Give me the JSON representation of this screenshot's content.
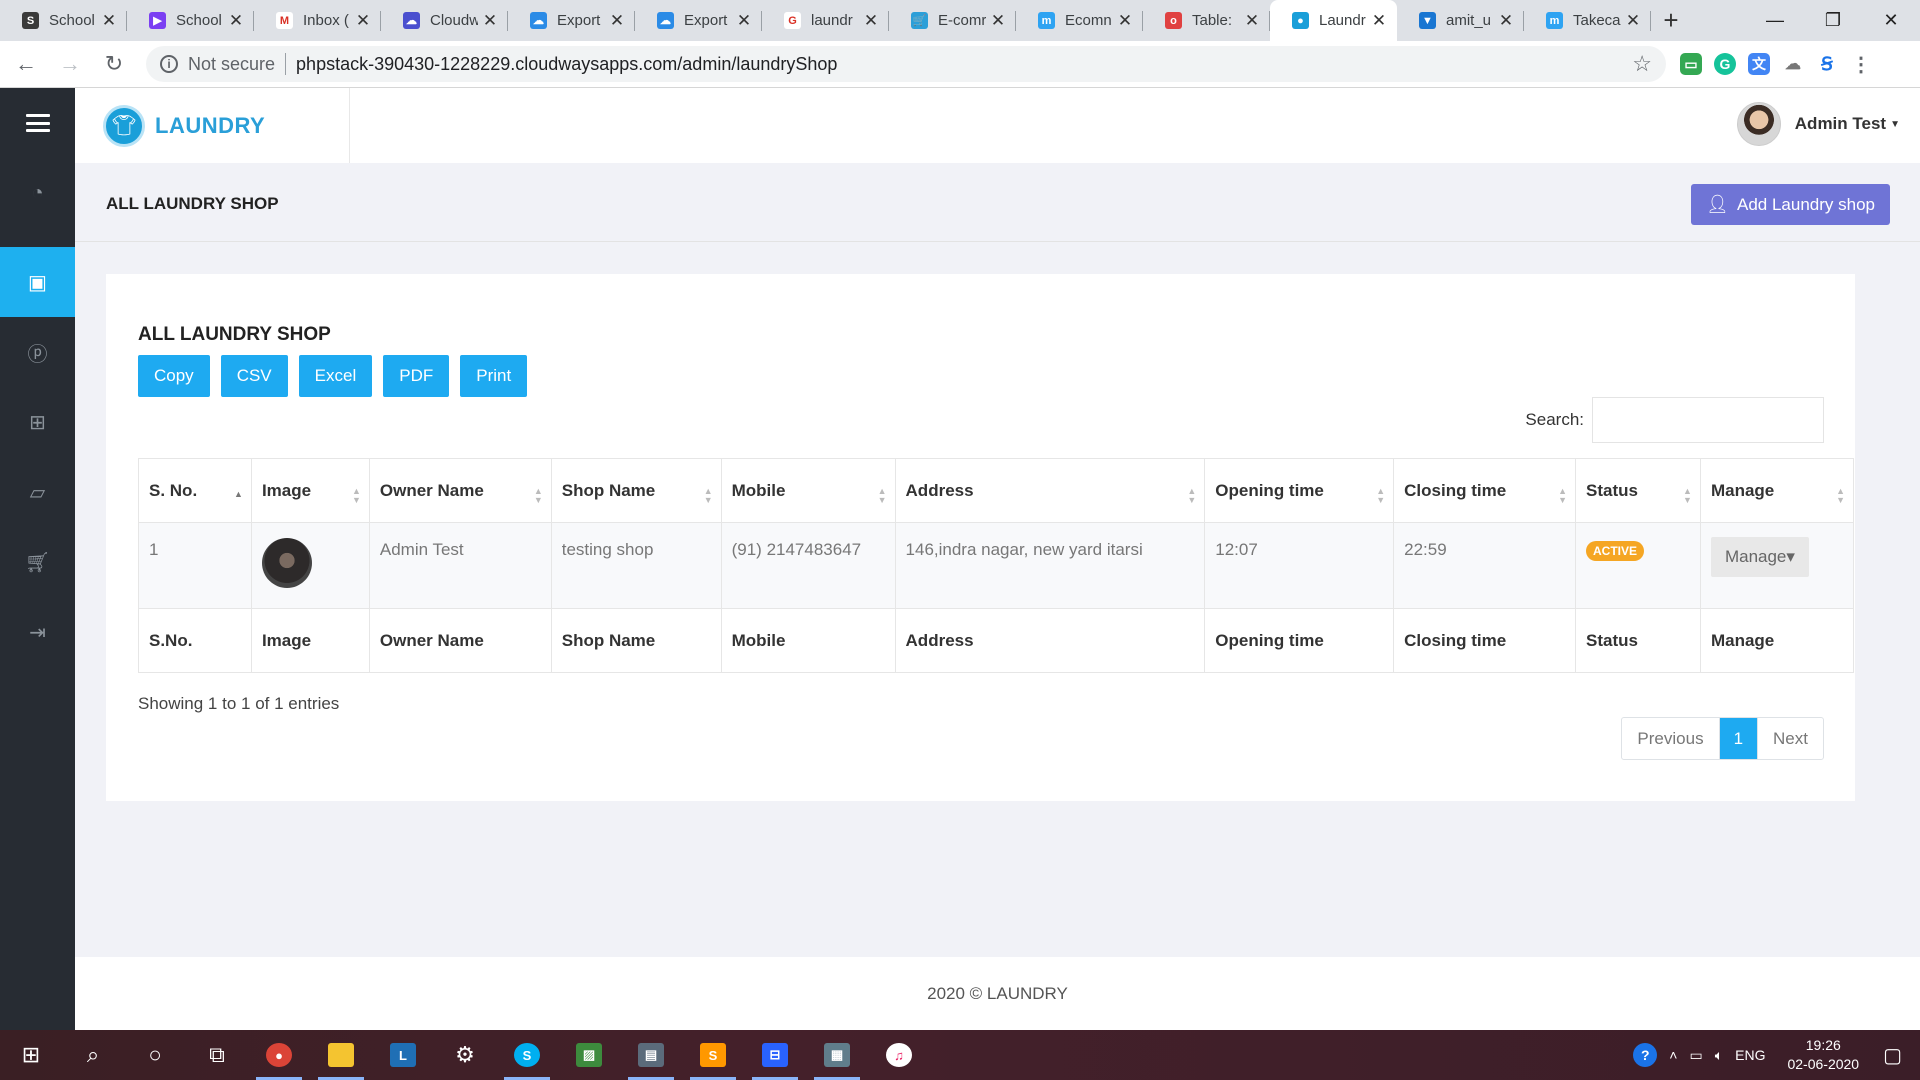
{
  "browser": {
    "tabs": [
      {
        "title": "School",
        "fav_color": "#3a3a3a",
        "fav_text": "S",
        "active": false
      },
      {
        "title": "School",
        "fav_color": "#7b3ff2",
        "fav_text": "▶",
        "active": false
      },
      {
        "title": "Inbox (",
        "fav_color": "#ffffff",
        "fav_text": "M",
        "active": false
      },
      {
        "title": "Cloudw",
        "fav_color": "#4a4fcf",
        "fav_text": "☁",
        "active": false
      },
      {
        "title": "Export",
        "fav_color": "#2b8be6",
        "fav_text": "☁",
        "active": false
      },
      {
        "title": "Export",
        "fav_color": "#2b8be6",
        "fav_text": "☁",
        "active": false
      },
      {
        "title": "laundr",
        "fav_color": "#ffffff",
        "fav_text": "G",
        "active": false
      },
      {
        "title": "E-comr",
        "fav_color": "#2c9fd8",
        "fav_text": "🛒",
        "active": false
      },
      {
        "title": "Ecomn",
        "fav_color": "#2ea3f2",
        "fav_text": "m",
        "active": false
      },
      {
        "title": "Table: ",
        "fav_color": "#e04141",
        "fav_text": "o",
        "active": false
      },
      {
        "title": "Laundr",
        "fav_color": "#1a9fd9",
        "fav_text": "●",
        "active": true
      },
      {
        "title": "amit_u",
        "fav_color": "#1976d2",
        "fav_text": "▼",
        "active": false
      },
      {
        "title": "Takeca",
        "fav_color": "#2ea3f2",
        "fav_text": "m",
        "active": false
      }
    ],
    "not_secure": "Not secure",
    "url": "phpstack-390430-1228229.cloudwaysapps.com/admin/laundryShop"
  },
  "app": {
    "brand": "LAUNDRY",
    "user_name": "Admin Test",
    "page_title": "ALL LAUNDRY SHOP",
    "add_button": "Add Laundry shop",
    "card_title": "ALL LAUNDRY SHOP",
    "export_buttons": [
      "Copy",
      "CSV",
      "Excel",
      "PDF",
      "Print"
    ],
    "search_label": "Search:",
    "columns": [
      "S. No.",
      "Image",
      "Owner Name",
      "Shop Name",
      "Mobile",
      "Address",
      "Opening time",
      "Closing time",
      "Status",
      "Manage"
    ],
    "footer_columns": [
      "S.No.",
      "Image",
      "Owner Name",
      "Shop Name",
      "Mobile",
      "Address",
      "Opening time",
      "Closing time",
      "Status",
      "Manage"
    ],
    "rows": [
      {
        "sno": "1",
        "owner": "Admin Test",
        "shop": "testing shop",
        "mobile": "(91) 2147483647",
        "address": "146,indra nagar, new yard itarsi",
        "opening": "12:07",
        "closing": "22:59",
        "status": "ACTIVE",
        "manage": "Manage"
      }
    ],
    "info": "Showing 1 to 1 of 1 entries",
    "pager": {
      "prev": "Previous",
      "current": "1",
      "next": "Next"
    },
    "footer": "2020 © LAUNDRY"
  },
  "taskbar": {
    "lang": "ENG",
    "time": "19:26",
    "date": "02-06-2020"
  },
  "colors": {
    "sidebar": "#272c33",
    "accent": "#1eb0ef",
    "add_button": "#6f74d6",
    "status_active": "#f5a623"
  }
}
